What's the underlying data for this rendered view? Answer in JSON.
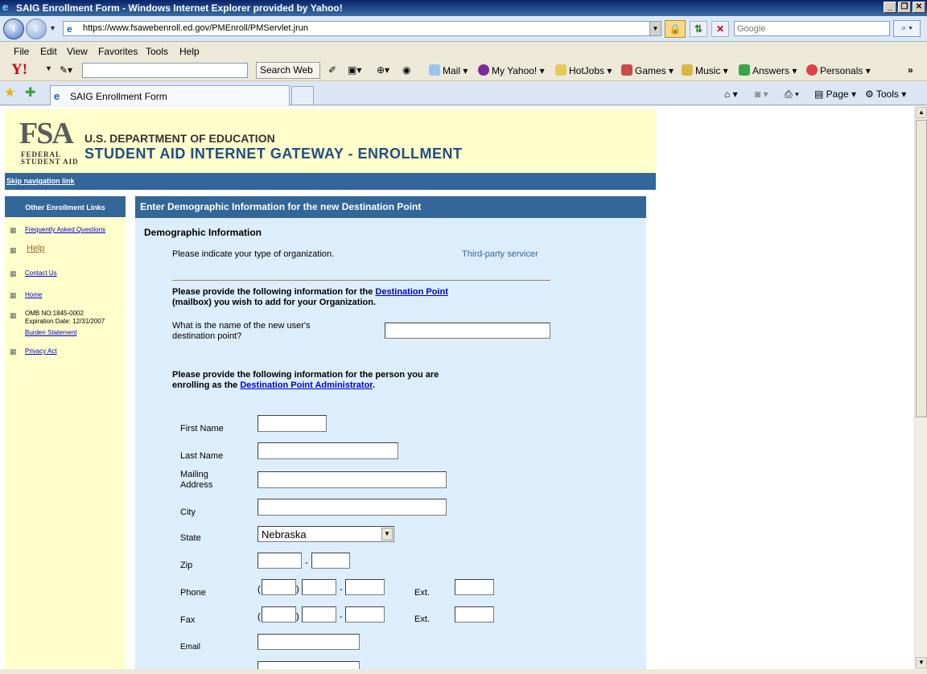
{
  "window": {
    "title": "SAIG Enrollment Form - Windows Internet Explorer provided by Yahoo!"
  },
  "address": {
    "url": "https://www.fsawebenroll.ed.gov/PMEnroll/PMServlet.jrun",
    "search_placeholder": "Google"
  },
  "menu": [
    "File",
    "Edit",
    "View",
    "Favorites",
    "Tools",
    "Help"
  ],
  "yahoo_toolbar": {
    "logo": "Y!",
    "search_web": "Search Web",
    "items": [
      "Mail",
      "My Yahoo!",
      "HotJobs",
      "Games",
      "Music",
      "Answers",
      "Personals"
    ],
    "more": "»"
  },
  "tabs": {
    "active": "SAIG Enrollment Form"
  },
  "command_bar": {
    "page": "Page",
    "tools": "Tools"
  },
  "header": {
    "logo_big": "FSA",
    "logo_small": "FEDERAL STUDENT AID",
    "dept": "U.S. DEPARTMENT OF EDUCATION",
    "title": "STUDENT AID INTERNET GATEWAY - ENROLLMENT",
    "skip": "Skip navigation link"
  },
  "leftnav": {
    "heading": "Other Enrollment Links",
    "faq": "Frequently Asked Questions",
    "help": "Help",
    "contact": "Contact Us",
    "home": "Home",
    "omb": "OMB NO:1845-0002",
    "expiration": "Expiration Date:  12/31/2007",
    "burden": "Burden Statement",
    "privacy": "Privacy Act"
  },
  "main": {
    "bar": "Enter Demographic Information for the new Destination Point",
    "section": "Demographic Information",
    "org_question": "Please indicate your type of organization.",
    "org_value": "Third-party servicer",
    "dp_intro_a": "Please provide the following information for the ",
    "dp_link": "Destination Point",
    "dp_intro_b": "(mailbox) you wish to add for your Organization.",
    "dp_name_q1": "What is the name of the new user's",
    "dp_name_q2": "destination point?",
    "admin_intro_a": "Please provide the following information for the person you are",
    "admin_intro_b": "enrolling as the ",
    "admin_link": "Destination Point Administrator",
    "admin_intro_c": ".",
    "labels": {
      "first_name": "First Name",
      "last_name": "Last Name",
      "mailing1": "Mailing",
      "mailing2": "Address",
      "city": "City",
      "state": "State",
      "zip": "Zip",
      "phone": "Phone",
      "fax": "Fax",
      "email": "Email",
      "ext": "Ext."
    },
    "state_value": "Nebraska"
  }
}
